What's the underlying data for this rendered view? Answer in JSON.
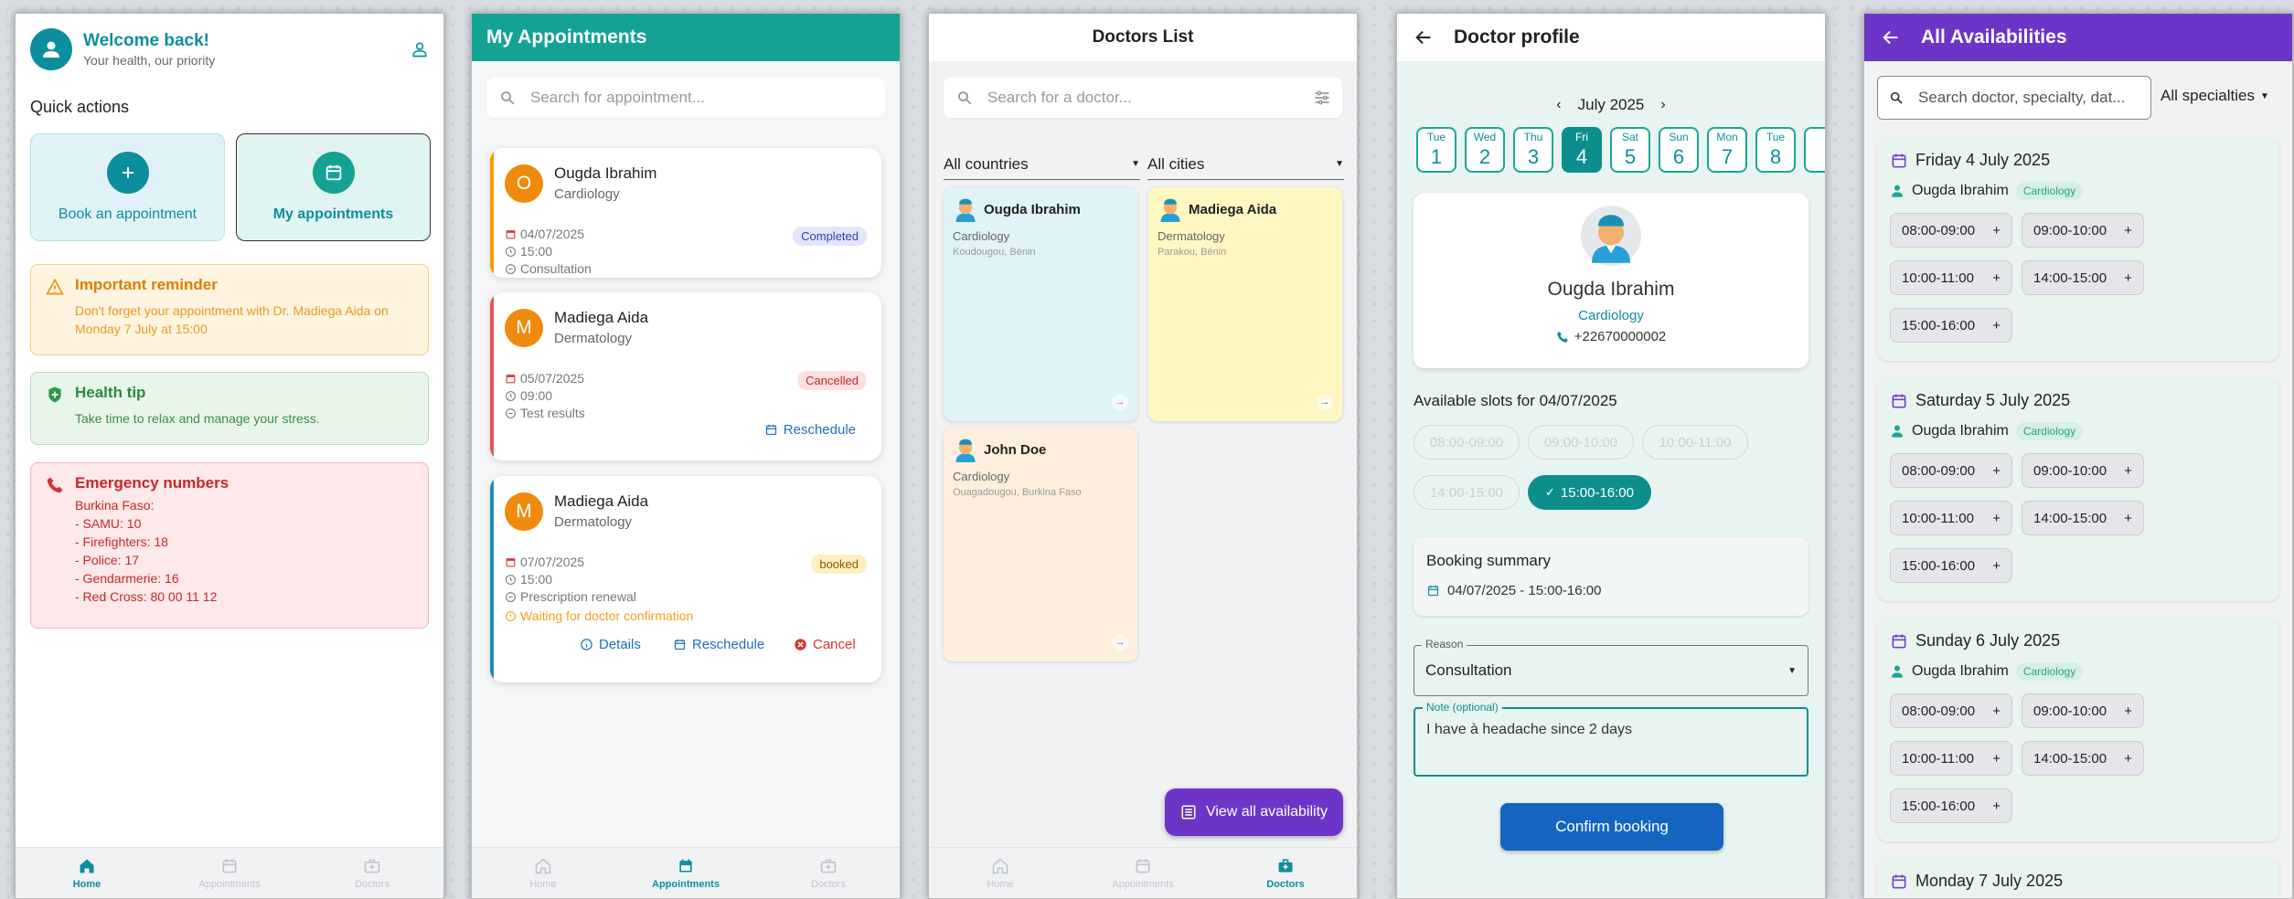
{
  "colors": {
    "teal": "#0d8e9e",
    "teal_bar": "#14a295",
    "purple": "#6c35c7",
    "blue_button": "#1565c0"
  },
  "home": {
    "welcome_title": "Welcome back!",
    "welcome_subtitle": "Your health, our priority",
    "quick_actions_title": "Quick actions",
    "book_label": "Book an appointment",
    "my_appointments_label": "My appointments",
    "reminder": {
      "title": "Important reminder",
      "body": "Don't forget your appointment with Dr. Madiega Aida on Monday 7 July at 15:00"
    },
    "health_tip": {
      "title": "Health tip",
      "body": "Take time to relax and manage your stress."
    },
    "emergency": {
      "title": "Emergency numbers",
      "lines": [
        "Burkina Faso:",
        "- SAMU: 10",
        "- Firefighters: 18",
        "- Police: 17",
        "- Gendarmerie: 16",
        "- Red Cross: 80 00 11 12"
      ]
    }
  },
  "nav": {
    "home": "Home",
    "appointments": "Appointments",
    "doctors": "Doctors"
  },
  "appointments": {
    "title": "My Appointments",
    "search_placeholder": "Search for appointment...",
    "items": [
      {
        "initial": "O",
        "name": "Ougda Ibrahim",
        "specialty": "Cardiology",
        "date": "04/07/2025",
        "time": "15:00",
        "reason": "Consultation",
        "status": "Completed"
      },
      {
        "initial": "M",
        "name": "Madiega Aida",
        "specialty": "Dermatology",
        "date": "05/07/2025",
        "time": "09:00",
        "reason": "Test results",
        "status": "Cancelled",
        "action": "Reschedule"
      },
      {
        "initial": "M",
        "name": "Madiega Aida",
        "specialty": "Dermatology",
        "date": "07/07/2025",
        "time": "15:00",
        "reason": "Prescription renewal",
        "status": "booked",
        "waiting": "Waiting for doctor confirmation",
        "details": "Details",
        "reschedule": "Reschedule",
        "cancel": "Cancel"
      }
    ]
  },
  "doctors": {
    "title": "Doctors List",
    "search_placeholder": "Search for a doctor...",
    "country_filter": "All countries",
    "city_filter": "All cities",
    "items": [
      {
        "name": "Ougda Ibrahim",
        "specialty": "Cardiology",
        "location": "Koudougou, Bénin"
      },
      {
        "name": "Madiega Aida",
        "specialty": "Dermatology",
        "location": "Parakou, Bénin"
      },
      {
        "name": "John Doe",
        "specialty": "Cardiology",
        "location": "Ouagadougou, Burkina Faso"
      }
    ],
    "view_all": "View all availability"
  },
  "profile": {
    "title": "Doctor profile",
    "month": "July 2025",
    "days": [
      {
        "dow": "Tue",
        "num": "1"
      },
      {
        "dow": "Wed",
        "num": "2"
      },
      {
        "dow": "Thu",
        "num": "3"
      },
      {
        "dow": "Fri",
        "num": "4"
      },
      {
        "dow": "Sat",
        "num": "5"
      },
      {
        "dow": "Sun",
        "num": "6"
      },
      {
        "dow": "Mon",
        "num": "7"
      },
      {
        "dow": "Tue",
        "num": "8"
      }
    ],
    "selected_day": "4",
    "name": "Ougda Ibrahim",
    "specialty": "Cardiology",
    "phone": "+22670000002",
    "slots_title": "Available slots for 04/07/2025",
    "slots": [
      "08:00-09:00",
      "09:00-10:00",
      "10:00-11:00",
      "14:00-15:00",
      "15:00-16:00"
    ],
    "selected_slot": "15:00-16:00",
    "summary_title": "Booking summary",
    "summary_value": "04/07/2025 - 15:00-16:00",
    "reason_label": "Reason",
    "reason_value": "Consultation",
    "note_label": "Note (optional)",
    "note_value": "I have à headache since 2 days",
    "confirm": "Confirm booking"
  },
  "availabilities": {
    "title": "All Availabilities",
    "search_placeholder": "Search doctor, specialty, dat...",
    "specialty_filter": "All specialties",
    "days": [
      {
        "date": "Friday 4 July 2025",
        "doctor": "Ougda Ibrahim",
        "specialty": "Cardiology",
        "slots": [
          "08:00-09:00",
          "09:00-10:00",
          "10:00-11:00",
          "14:00-15:00",
          "15:00-16:00"
        ]
      },
      {
        "date": "Saturday 5 July 2025",
        "doctor": "Ougda Ibrahim",
        "specialty": "Cardiology",
        "slots": [
          "08:00-09:00",
          "09:00-10:00",
          "10:00-11:00",
          "14:00-15:00",
          "15:00-16:00"
        ]
      },
      {
        "date": "Sunday 6 July 2025",
        "doctor": "Ougda Ibrahim",
        "specialty": "Cardiology",
        "slots": [
          "08:00-09:00",
          "09:00-10:00",
          "10:00-11:00",
          "14:00-15:00",
          "15:00-16:00"
        ]
      },
      {
        "date": "Monday 7 July 2025"
      }
    ]
  }
}
